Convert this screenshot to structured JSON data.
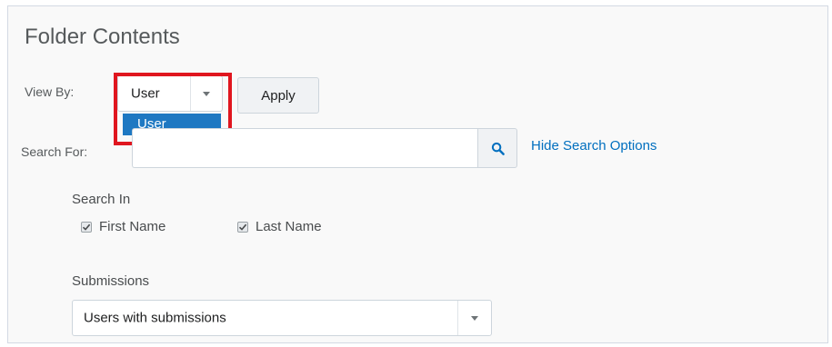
{
  "page": {
    "title": "Folder Contents"
  },
  "view_by": {
    "label": "View By:",
    "selected": "User",
    "options": [
      "User"
    ],
    "apply_label": "Apply"
  },
  "search": {
    "label": "Search For:",
    "value": "",
    "placeholder": "",
    "icon": "search-icon",
    "hide_options_label": "Hide Search Options"
  },
  "search_in": {
    "label": "Search In",
    "options": [
      {
        "label": "First Name",
        "checked": true
      },
      {
        "label": "Last Name",
        "checked": true
      }
    ]
  },
  "submissions": {
    "label": "Submissions",
    "selected": "Users with submissions"
  },
  "colors": {
    "highlight": "#e0161f",
    "selected_option": "#1e78c2",
    "link": "#006fbf"
  }
}
